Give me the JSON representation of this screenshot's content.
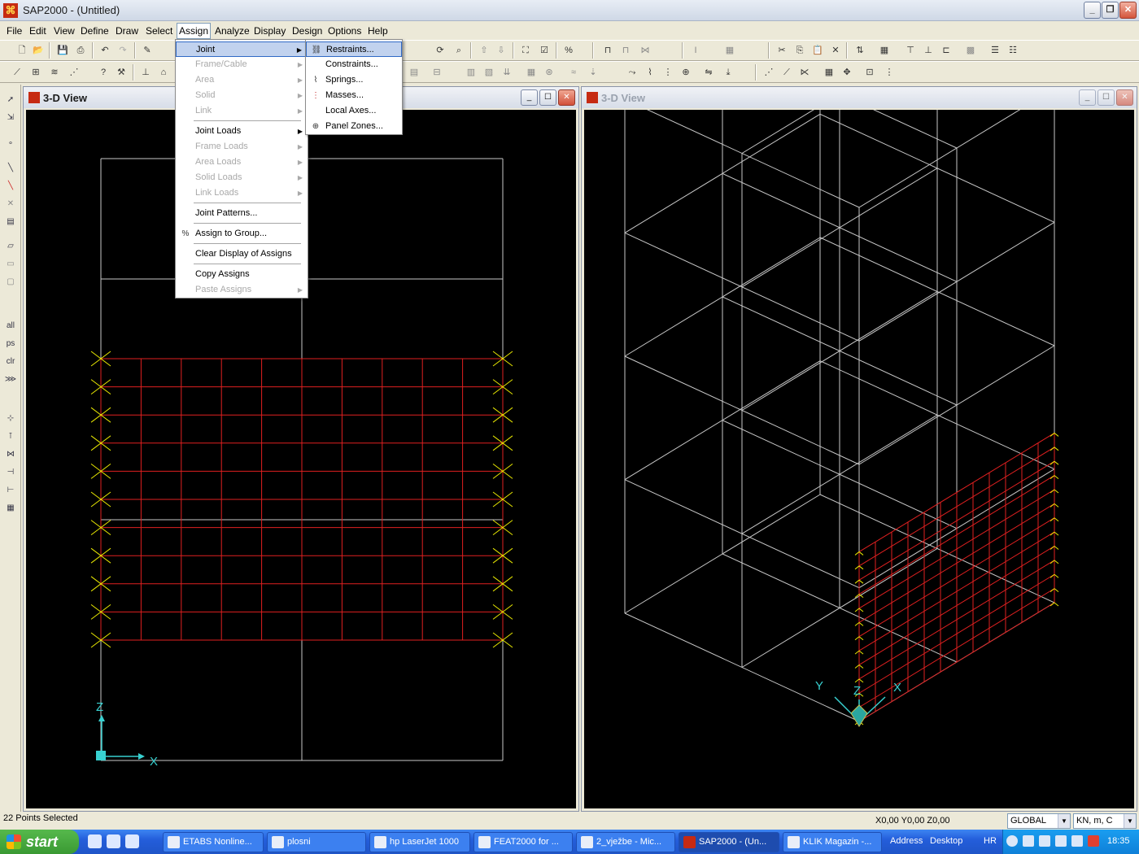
{
  "app": {
    "title": "SAP2000 - (Untitled)",
    "logo_glyph": "⌘",
    "window_buttons": {
      "minimize": "_",
      "maximize": "❐",
      "close": "✕"
    }
  },
  "menubar": {
    "items": [
      "File",
      "Edit",
      "View",
      "Define",
      "Draw",
      "Select",
      "Assign",
      "Analyze",
      "Display",
      "Design",
      "Options",
      "Help"
    ],
    "active": "Assign"
  },
  "assign_menu": {
    "items": [
      {
        "label": "Joint",
        "state": "highlighted",
        "submenu": true
      },
      {
        "label": "Frame/Cable",
        "state": "disabled",
        "submenu": true
      },
      {
        "label": "Area",
        "state": "disabled",
        "submenu": true
      },
      {
        "label": "Solid",
        "state": "disabled",
        "submenu": true
      },
      {
        "label": "Link",
        "state": "disabled",
        "submenu": true
      },
      {
        "label": "Joint Loads",
        "state": "enabled",
        "submenu": true
      },
      {
        "label": "Frame Loads",
        "state": "disabled",
        "submenu": true
      },
      {
        "label": "Area Loads",
        "state": "disabled",
        "submenu": true
      },
      {
        "label": "Solid Loads",
        "state": "disabled",
        "submenu": true
      },
      {
        "label": "Link Loads",
        "state": "disabled",
        "submenu": true
      },
      {
        "label": "Joint Patterns...",
        "state": "enabled",
        "submenu": false
      },
      {
        "label": "Assign to Group...",
        "state": "enabled",
        "submenu": false
      },
      {
        "label": "Clear Display of Assigns",
        "state": "enabled",
        "submenu": false
      },
      {
        "label": "Copy Assigns",
        "state": "enabled",
        "submenu": false
      },
      {
        "label": "Paste Assigns",
        "state": "disabled",
        "submenu": true
      }
    ]
  },
  "joint_submenu": {
    "items": [
      {
        "label": "Restraints...",
        "icon": "restraints-icon",
        "state": "highlighted"
      },
      {
        "label": "Constraints...",
        "icon": "constraints-icon",
        "state": "enabled"
      },
      {
        "label": "Springs...",
        "icon": "springs-icon",
        "state": "enabled"
      },
      {
        "label": "Masses...",
        "icon": "masses-icon",
        "state": "enabled"
      },
      {
        "label": "Local Axes...",
        "icon": "local-axes-icon",
        "state": "enabled"
      },
      {
        "label": "Panel Zones...",
        "icon": "panel-zones-icon",
        "state": "enabled"
      }
    ]
  },
  "left_view": {
    "title": "3-D View",
    "state": "active",
    "axis_labels": {
      "z": "Z",
      "x": "X"
    }
  },
  "right_view": {
    "title": "3-D View",
    "state": "inactive",
    "axis_labels": {
      "y": "Y",
      "z": "Z",
      "x": "X"
    }
  },
  "toolbar_left_labels": {
    "all": "all",
    "ps": "ps",
    "clr": "clr"
  },
  "status": {
    "selection": "22 Points Selected",
    "coordinates": "X0,00  Y0,00  Z0,00",
    "coord_system": "GLOBAL",
    "units": "KN, m, C"
  },
  "taskbar": {
    "start_label": "start",
    "tasks": [
      {
        "label": "ETABS Nonline...",
        "active": false
      },
      {
        "label": "plosni",
        "active": false
      },
      {
        "label": "hp LaserJet 1000",
        "active": false
      },
      {
        "label": "FEAT2000 for ...",
        "active": false
      },
      {
        "label": "2_vježbe - Mic...",
        "active": false
      },
      {
        "label": "SAP2000 - (Un...",
        "active": true
      },
      {
        "label": "KLIK Magazin -...",
        "active": false
      }
    ],
    "address_label": "Address",
    "desktop_label": "Desktop",
    "language": "HR",
    "clock": "18:35"
  },
  "colors": {
    "frame_gray": "#c8c8c8",
    "shell_red": "#e02020",
    "restraint_yellow": "#e8e800",
    "axis_cyan": "#38d0d0"
  }
}
